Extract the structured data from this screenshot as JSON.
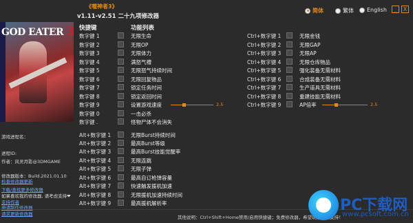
{
  "header": {
    "game_title": "《噬神者3》",
    "version": "v1.11-v2.51 二十九项修改器"
  },
  "languages": [
    {
      "label": "简体",
      "selected": true
    },
    {
      "label": "繁体",
      "selected": false
    },
    {
      "label": "English",
      "selected": false
    }
  ],
  "window_buttons": {
    "minimize": "_",
    "close": "X"
  },
  "cover": {
    "logo_text": "GOD EATER",
    "logo_num": "3"
  },
  "info": {
    "process_name_label": "游戏进程名：",
    "process_id_label": "进程ID:",
    "author": "作者：风灵月影@3DMGAME",
    "build": "修改器版本：Build.2021.01.10",
    "check_update": "检查修改器更新",
    "download_more": "下载/查找更多修改器",
    "support_text": "如果喜欢我的修改器, 请考虑支持❤",
    "support_me": "支持作者",
    "request_trainer": "申请制作修改器",
    "request_update": "请求更新修改器"
  },
  "column_headers": {
    "hotkey": "快捷键",
    "features": "功能列表"
  },
  "left_rows": [
    {
      "key": "数字键 1",
      "fn": "无限生命"
    },
    {
      "key": "数字键 2",
      "fn": "无限OP"
    },
    {
      "key": "数字键 3",
      "fn": "无限体力"
    },
    {
      "key": "数字键 4",
      "fn": "满怒气槽"
    },
    {
      "key": "数字键 5",
      "fn": "无限怒气持续时间"
    },
    {
      "key": "数字键 6",
      "fn": "无限回复物品"
    },
    {
      "key": "数字键 7",
      "fn": "锁定任务时间"
    },
    {
      "key": "数字键 8",
      "fn": "锁定返回时间"
    },
    {
      "key": "数字键 9",
      "fn": "设置游戏速度"
    },
    {
      "key": "数字键 0",
      "fn": "一击必杀"
    },
    {
      "key": "数字键 .",
      "fn": "怪物尸体不会消失"
    }
  ],
  "alt_rows": [
    {
      "key": "Alt+数字键 1",
      "fn": "无限Burst持续时间"
    },
    {
      "key": "Alt+数字键 2",
      "fn": "最高Burst等级"
    },
    {
      "key": "Alt+数字键 3",
      "fn": "最高Burst技能觉醒率"
    },
    {
      "key": "Alt+数字键 4",
      "fn": "无限连跳"
    },
    {
      "key": "Alt+数字键 5",
      "fn": "无限子弹"
    },
    {
      "key": "Alt+数字键 6",
      "fn": "最高自订枪弹容量"
    },
    {
      "key": "Alt+数字键 7",
      "fn": "快速触发援机加速"
    },
    {
      "key": "Alt+数字键 8",
      "fn": "无限援机加速持续时间"
    },
    {
      "key": "Alt+数字键 9",
      "fn": "最高援机解析率"
    }
  ],
  "ctrl_rows": [
    {
      "key": "Ctrl+数字键 1",
      "fn": "无限金钱"
    },
    {
      "key": "Ctrl+数字键 2",
      "fn": "无限GAP"
    },
    {
      "key": "Ctrl+数字键 3",
      "fn": "无限AP"
    },
    {
      "key": "Ctrl+数字键 4",
      "fn": "无限仓库物品"
    },
    {
      "key": "Ctrl+数字键 5",
      "fn": "强化装备无需材料"
    },
    {
      "key": "Ctrl+数字键 6",
      "fn": "合成装备无需材料"
    },
    {
      "key": "Ctrl+数字键 7",
      "fn": "生产道具无需材料"
    },
    {
      "key": "Ctrl+数字键 8",
      "fn": "重建技能无需材料"
    },
    {
      "key": "Ctrl+数字键 9",
      "fn": "AP倍率"
    }
  ],
  "sliders": {
    "game_speed": {
      "value_label": "2.5",
      "fraction": 0.3
    },
    "ap_multiplier": {
      "value_label": "2.5",
      "fraction": 0.3
    }
  },
  "footer": {
    "text": "其他说明：Ctrl+Shift+Home禁用/启用快捷键；免费修改器，希望玩家广告支持！"
  },
  "watermark": {
    "brand": "PC下载网",
    "url": "www.pcsoft.com.cn"
  },
  "colors": {
    "accent": "#e08a1e",
    "link": "#6ea4ff",
    "background": "#2b2b2b"
  }
}
